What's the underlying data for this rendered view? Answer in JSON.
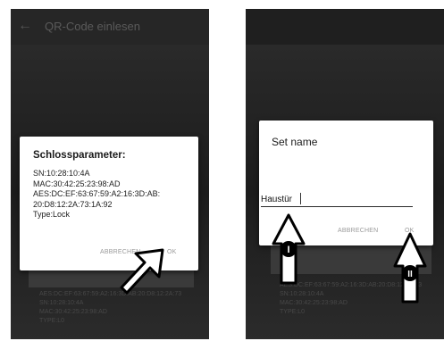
{
  "app": {
    "title": "QR-Code einlesen"
  },
  "left_dialog": {
    "title": "Schlossparameter:",
    "params": [
      "SN:10:28:10:4A",
      "MAC:30:42:25:23:98:AD",
      "AES:DC:EF:63:67:59:A2:16:3D:AB:",
      "20:D8:12:2A:73:1A:92",
      "Type:Lock"
    ],
    "cancel_label": "ABBRECHEN",
    "ok_label": "OK"
  },
  "right_dialog": {
    "title": "Set name",
    "name_value": "Haustür",
    "cancel_label": "ABBRECHEN",
    "ok_label": "OK"
  },
  "background_text": {
    "left": [
      "AES:DC:EF:63:67:59:A2:16:3D:AB:20:D8:12:2A:73",
      "SN:10:28:10:4A",
      "MAC:30:42:25:23:98:AD",
      "TYPE:L0"
    ],
    "right": [
      "AES:DC:EF:63:67:59:A2:16:3D:AB:20:D8:12:2A:73",
      "SN:10:28:10:4A",
      "MAC:30:42:25:23:98:AD",
      "TYPE:L0"
    ]
  },
  "annotations": {
    "marker_1": "I",
    "marker_2": "II"
  },
  "colors": {
    "phone_bg": "#1f1f1f",
    "dialog_bg": "#ffffff",
    "button_text": "#9a9a9a"
  }
}
